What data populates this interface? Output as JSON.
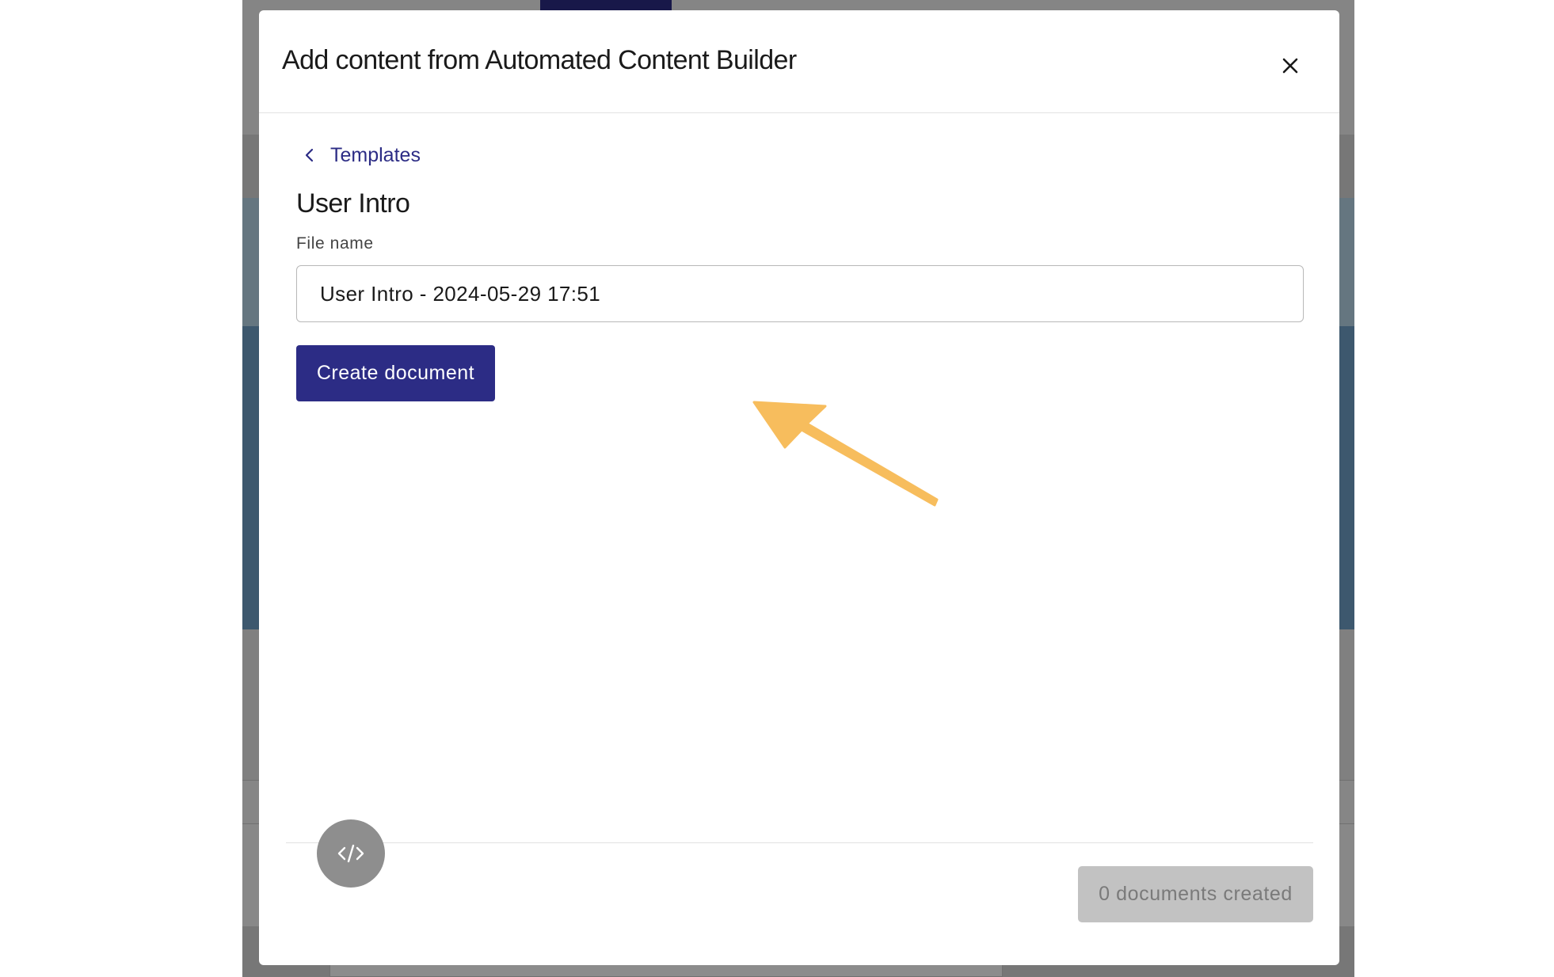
{
  "modal": {
    "title": "Add content from Automated Content Builder",
    "close_icon": "close-icon"
  },
  "breadcrumb": {
    "icon": "chevron-left-icon",
    "label": "Templates"
  },
  "template": {
    "title": "User Intro",
    "file_name_label": "File name",
    "file_name_value": "User Intro - 2024-05-29 17:51",
    "create_label": "Create document"
  },
  "footer": {
    "code_icon": "code-icon",
    "documents_created_label": "0 documents created"
  },
  "colors": {
    "accent": "#2c2c85",
    "annotation_arrow": "#f7bd5d",
    "disabled_button": "#c2c2c2"
  }
}
